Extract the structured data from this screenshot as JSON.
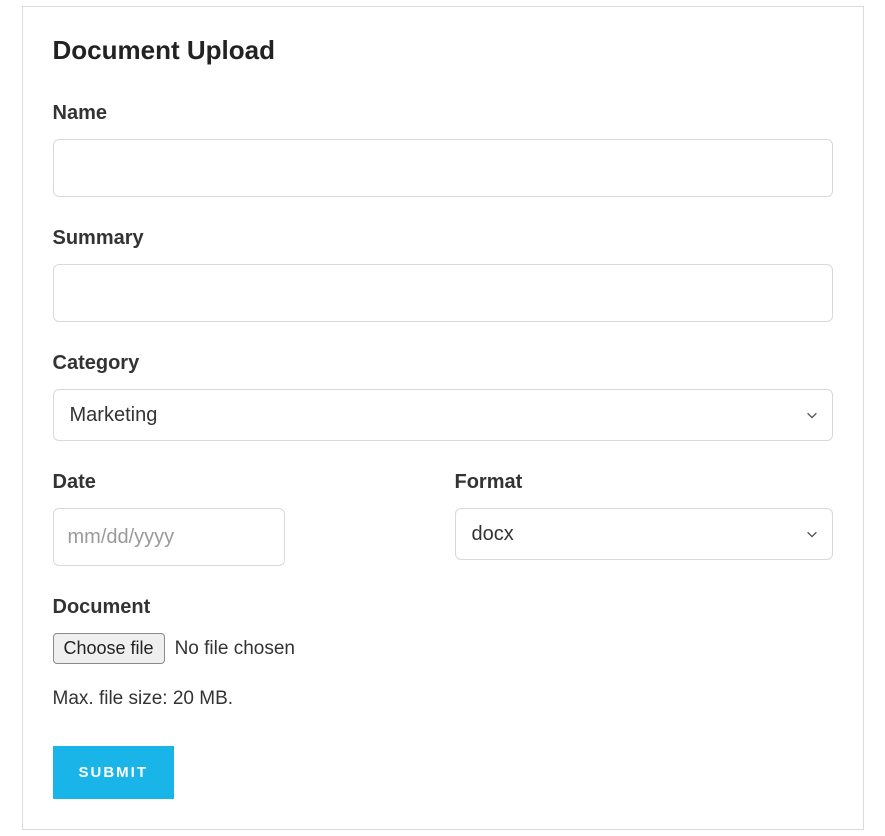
{
  "card": {
    "title": "Document Upload"
  },
  "fields": {
    "name": {
      "label": "Name",
      "value": ""
    },
    "summary": {
      "label": "Summary",
      "value": ""
    },
    "category": {
      "label": "Category",
      "selected": "Marketing"
    },
    "date": {
      "label": "Date",
      "placeholder": "mm/dd/yyyy",
      "value": ""
    },
    "format": {
      "label": "Format",
      "selected": "docx"
    },
    "document": {
      "label": "Document",
      "choose_button": "Choose file",
      "status": "No file chosen",
      "hint": "Max. file size: 20 MB."
    }
  },
  "actions": {
    "submit": "Submit"
  }
}
